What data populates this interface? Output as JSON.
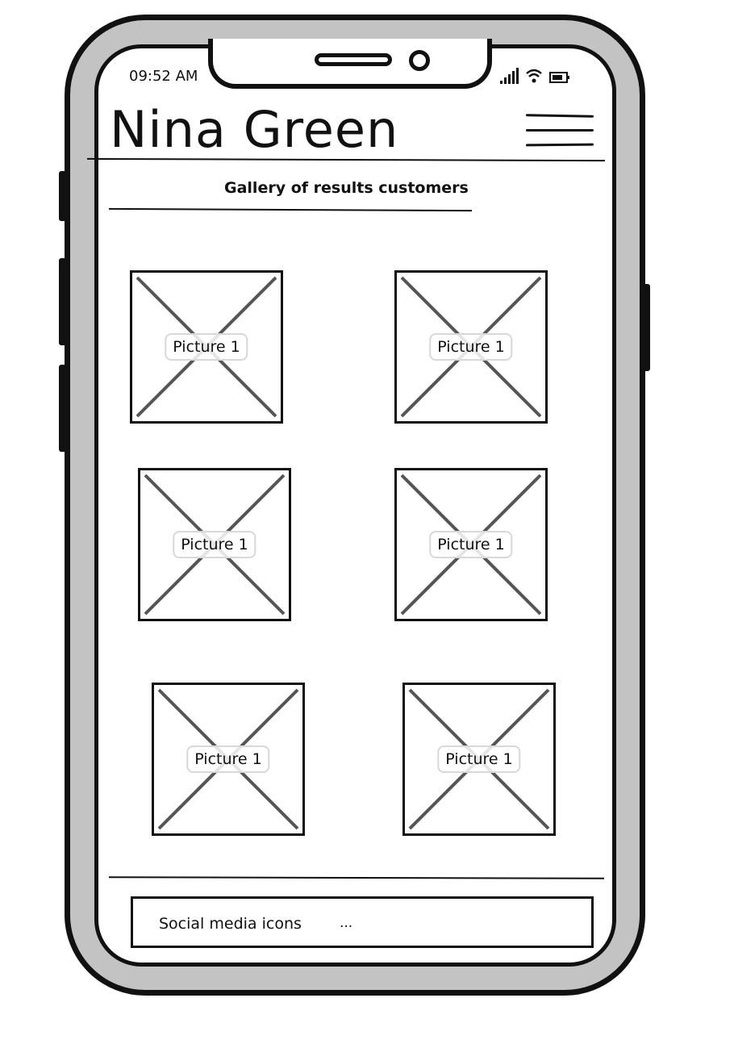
{
  "status_bar": {
    "time": "09:52 AM",
    "icons": [
      "signal-icon",
      "wifi-icon",
      "battery-icon"
    ]
  },
  "header": {
    "title": "Nina Green",
    "menu_icon": "hamburger-menu-icon"
  },
  "gallery": {
    "heading": "Gallery of results customers",
    "pictures": [
      {
        "label": "Picture 1"
      },
      {
        "label": "Picture 1"
      },
      {
        "label": "Picture 1"
      },
      {
        "label": "Picture 1"
      },
      {
        "label": "Picture 1"
      },
      {
        "label": "Picture 1"
      }
    ]
  },
  "footer": {
    "label": "Social media icons",
    "more": "..."
  },
  "colors": {
    "frame": "#111111",
    "bezel": "#c3c3c3",
    "screen": "#ffffff",
    "placeholder_cross": "#555555"
  }
}
